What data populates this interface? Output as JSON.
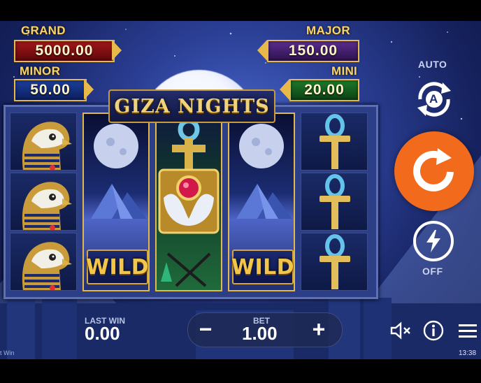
{
  "title": "GIZA NIGHTS",
  "jackpots": {
    "grand": {
      "label": "GRAND",
      "value": "5000.00"
    },
    "minor": {
      "label": "MINOR",
      "value": "50.00"
    },
    "major": {
      "label": "MAJOR",
      "value": "150.00"
    },
    "mini": {
      "label": "MINI",
      "value": "20.00"
    }
  },
  "reels": {
    "wild_label": "WILD",
    "columns": [
      {
        "symbols": [
          "falcon-icon",
          "falcon-icon",
          "falcon-icon"
        ]
      },
      {
        "symbols": [
          "wild-moon-pyramid-icon"
        ]
      },
      {
        "symbols": [
          "scarab-wild-icon"
        ]
      },
      {
        "symbols": [
          "wild-moon-pyramid-icon"
        ]
      },
      {
        "symbols": [
          "ankh-icon",
          "ankh-icon",
          "ankh-icon"
        ]
      }
    ]
  },
  "controls": {
    "auto_label": "AUTO",
    "auto_letter": "A",
    "turbo_label": "OFF"
  },
  "bottom_bar": {
    "last_win_label": "LAST WIN",
    "last_win_value": "0.00",
    "bet_label": "BET",
    "bet_value": "1.00",
    "minus": "−",
    "plus": "+",
    "corner_text": "t Win"
  },
  "status": {
    "time": "13:38"
  },
  "colors": {
    "accent": "#f26a1b",
    "gold": "#e8b94a",
    "background": "#1e2d74"
  }
}
